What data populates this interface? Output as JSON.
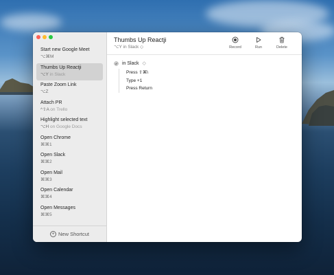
{
  "window": {
    "title": "Thumbs Up Reactji",
    "subtitle": "⌥Y in Slack ◇",
    "toolbar": [
      {
        "label": "Record",
        "icon": "record-icon"
      },
      {
        "label": "Run",
        "icon": "play-icon"
      },
      {
        "label": "Delete",
        "icon": "trash-icon"
      }
    ]
  },
  "sidebar": {
    "items": [
      {
        "name": "Start new Google Meet",
        "shortcut": "⌥⌘M",
        "app": "",
        "selected": false
      },
      {
        "name": "Thumbs Up Reactji",
        "shortcut": "⌥Y",
        "app": "in Slack",
        "selected": true
      },
      {
        "name": "Paste Zoom Link",
        "shortcut": "⌥Z",
        "app": "",
        "selected": false
      },
      {
        "name": "Attach PR",
        "shortcut": "^⇧A",
        "app": "on Trello",
        "selected": false
      },
      {
        "name": "Highlight selected text",
        "shortcut": "⌥H",
        "app": "on Google Docs",
        "selected": false
      },
      {
        "name": "Open Chrome",
        "shortcut": "⌘⌘1",
        "app": "",
        "selected": false
      },
      {
        "name": "Open Slack",
        "shortcut": "⌘⌘2",
        "app": "",
        "selected": false
      },
      {
        "name": "Open Mail",
        "shortcut": "⌘⌘3",
        "app": "",
        "selected": false
      },
      {
        "name": "Open Calendar",
        "shortcut": "⌘⌘4",
        "app": "",
        "selected": false
      },
      {
        "name": "Open Messages",
        "shortcut": "⌘⌘5",
        "app": "",
        "selected": false
      }
    ],
    "new_shortcut_label": "New Shortcut"
  },
  "steps": {
    "app_scope": "in Slack",
    "actions": [
      "Press ⇧⌘\\",
      "Type +1",
      "Press Return"
    ]
  },
  "colors": {
    "close": "#fe5f57",
    "minimize": "#febc2e",
    "zoom": "#28c840",
    "selected_row": "#d2d2d2",
    "sidebar_bg": "#ececec"
  }
}
